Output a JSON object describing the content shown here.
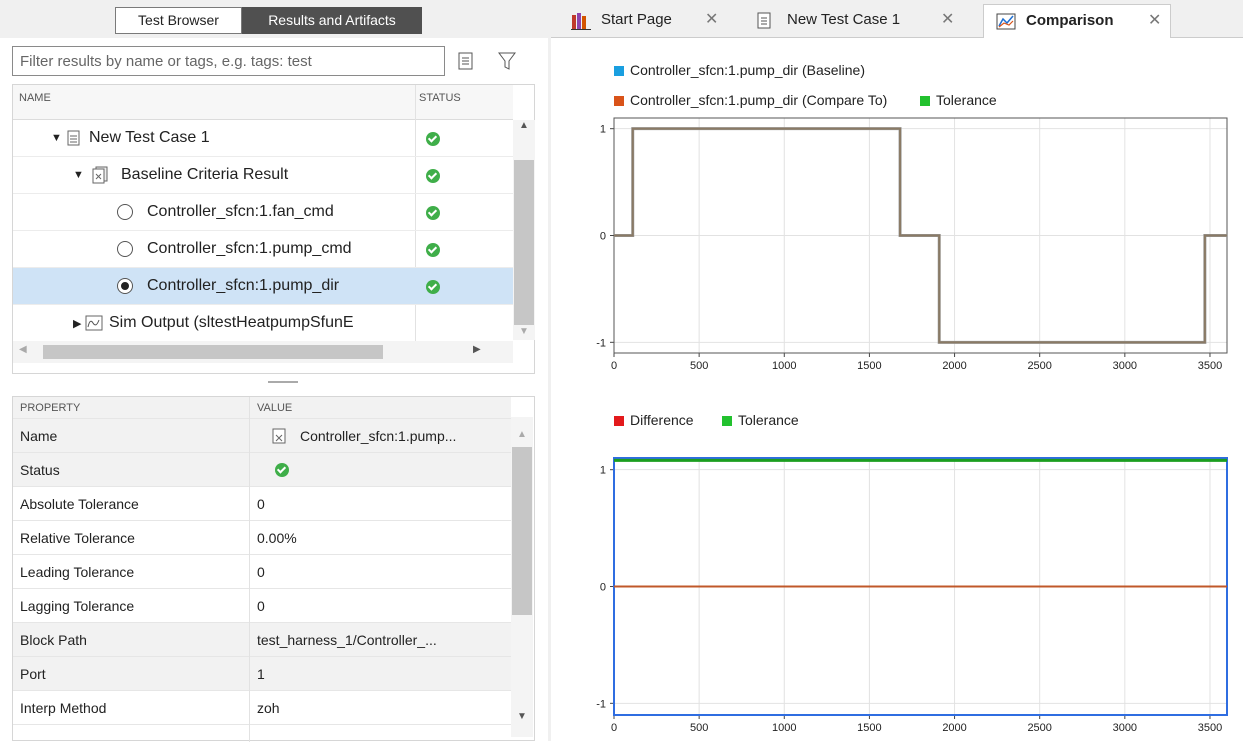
{
  "left_panel": {
    "tabs": [
      "Test Browser",
      "Results and Artifacts"
    ],
    "filter_placeholder": "Filter results by name or tags, e.g. tags: test",
    "tree": {
      "col_name": "NAME",
      "col_status": "STATUS",
      "rows": [
        {
          "label": "New Test Case 1",
          "status": "pass"
        },
        {
          "label": "Baseline Criteria Result",
          "status": "pass"
        },
        {
          "label": "Controller_sfcn:1.fan_cmd",
          "status": "pass"
        },
        {
          "label": "Controller_sfcn:1.pump_cmd",
          "status": "pass"
        },
        {
          "label": "Controller_sfcn:1.pump_dir",
          "status": "pass",
          "selected": true
        },
        {
          "label": "Sim Output (sltestHeatpumpSfunE",
          "status": ""
        }
      ]
    },
    "properties": {
      "col_property": "PROPERTY",
      "col_value": "VALUE",
      "rows": [
        {
          "key": "Name",
          "value": "Controller_sfcn:1.pump..."
        },
        {
          "key": "Status",
          "value": ""
        },
        {
          "key": "Absolute Tolerance",
          "value": "0"
        },
        {
          "key": "Relative Tolerance",
          "value": "0.00%"
        },
        {
          "key": "Leading Tolerance",
          "value": "0"
        },
        {
          "key": "Lagging Tolerance",
          "value": "0"
        },
        {
          "key": "Block Path",
          "value": "test_harness_1/Controller_..."
        },
        {
          "key": "Port",
          "value": "1"
        },
        {
          "key": "Interp Method",
          "value": "zoh"
        }
      ]
    }
  },
  "right_panel": {
    "tabs": [
      {
        "label": "Start Page",
        "icon": "library-icon",
        "active": false
      },
      {
        "label": "New Test Case 1",
        "icon": "document-icon",
        "active": false
      },
      {
        "label": "Comparison",
        "icon": "plot-icon",
        "active": true
      }
    ],
    "legend_top": [
      {
        "label": "Controller_sfcn:1.pump_dir (Baseline)",
        "color": "#1a9fe0"
      },
      {
        "label": "Controller_sfcn:1.pump_dir (Compare To)",
        "color": "#d95319"
      },
      {
        "label": "Tolerance",
        "color": "#22c12e"
      }
    ],
    "legend_bottom": [
      {
        "label": "Difference",
        "color": "#e31a1c"
      },
      {
        "label": "Tolerance",
        "color": "#22c12e"
      }
    ]
  },
  "chart_data": [
    {
      "type": "line",
      "title": "",
      "x_ticks": [
        0,
        500,
        1000,
        1500,
        2000,
        2500,
        3000,
        3500
      ],
      "y_ticks": [
        1,
        0,
        -1
      ],
      "xlim": [
        0,
        3600
      ],
      "ylim": [
        -1.1,
        1.1
      ],
      "grid": true,
      "series": [
        {
          "name": "Controller_sfcn:1.pump_dir (Baseline)",
          "step": true,
          "x": [
            0,
            110,
            110,
            1680,
            1680,
            1910,
            1910,
            3470,
            3470,
            3600
          ],
          "y": [
            0,
            0,
            1,
            1,
            0,
            0,
            -1,
            -1,
            0,
            0
          ]
        },
        {
          "name": "Controller_sfcn:1.pump_dir (Compare To)",
          "step": true,
          "x": [
            0,
            110,
            110,
            1680,
            1680,
            1910,
            1910,
            3470,
            3470,
            3600
          ],
          "y": [
            0,
            0,
            1,
            1,
            0,
            0,
            -1,
            -1,
            0,
            0
          ]
        }
      ]
    },
    {
      "type": "line",
      "title": "",
      "x_ticks": [
        0,
        500,
        1000,
        1500,
        2000,
        2500,
        3000,
        3500
      ],
      "y_ticks": [
        1,
        0,
        -1
      ],
      "xlim": [
        0,
        3600
      ],
      "ylim": [
        -1.1,
        1.1
      ],
      "grid": true,
      "series": [
        {
          "name": "Difference",
          "x": [
            0,
            3600
          ],
          "y": [
            0,
            0
          ]
        },
        {
          "name": "Tolerance",
          "x": [
            0,
            3600
          ],
          "y": [
            1.08,
            1.08
          ]
        }
      ]
    }
  ]
}
